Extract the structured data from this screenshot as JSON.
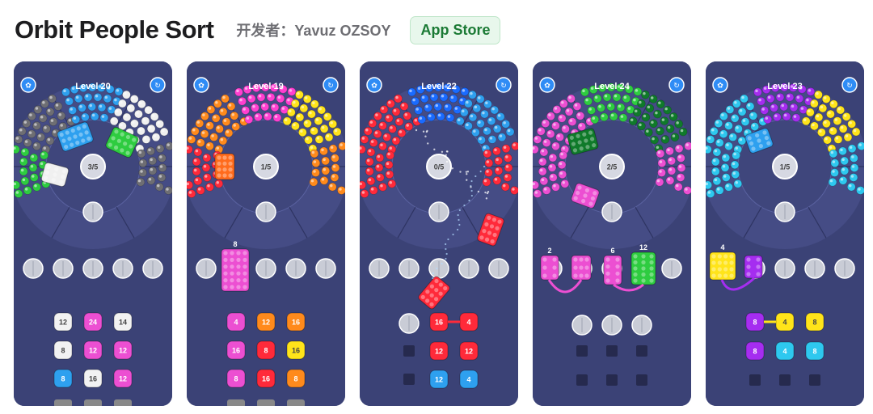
{
  "app": {
    "title": "Orbit People Sort",
    "developer": "开发者：Yavuz OZSOY",
    "store_badge": "App Store"
  },
  "screenshots": [
    {
      "level": "Level 20",
      "progress": "3/5",
      "colors": [
        "#6e6e73",
        "#2ea0ef",
        "#f0f0f0",
        "#2ecc40"
      ],
      "tray_labels": [
        "12",
        "24",
        "14",
        "8",
        "12",
        "12",
        "8",
        "16",
        "12"
      ],
      "tray_colors": [
        "#f2f2f2",
        "#ec4fd2",
        "#f2f2f2",
        "#f2f2f2",
        "#ec4fd2",
        "#ec4fd2",
        "#2ea0ef",
        "#f2f2f2",
        "#ec4fd2"
      ]
    },
    {
      "level": "Level 19",
      "progress": "1/5",
      "colors": [
        "#ff8a1c",
        "#ff3fd0",
        "#ffe41a",
        "#ff2a3a"
      ],
      "tray_labels": [
        "4",
        "12",
        "16",
        "16",
        "8",
        "16",
        "8",
        "16",
        "8"
      ],
      "tray_colors": [
        "#ec4fd2",
        "#ff8a1c",
        "#ff8a1c",
        "#ec4fd2",
        "#ff2a3a",
        "#ffe41a",
        "#ec4fd2",
        "#ff2a3a",
        "#ff8a1c"
      ],
      "box_label": "8"
    },
    {
      "level": "Level 22",
      "progress": "0/5",
      "colors": [
        "#ff2a3a",
        "#1a6bff",
        "#2ea0ef",
        "#ff2a3a"
      ],
      "tray_labels": [
        "16",
        "4",
        "12",
        "12",
        "12",
        "4"
      ],
      "tray_colors": [
        "#ff2a3a",
        "#ff2a3a",
        "#ff2a3a",
        "#ff2a3a",
        "#2ea0ef",
        "#2ea0ef"
      ]
    },
    {
      "level": "Level 24",
      "progress": "2/5",
      "colors": [
        "#ec4fd2",
        "#2ecc40",
        "#0f7a2a",
        "#ec4fd2"
      ],
      "box_labels": [
        "2",
        "6",
        "12"
      ]
    },
    {
      "level": "Level 23",
      "progress": "1/5",
      "colors": [
        "#2ec8ef",
        "#a52df0",
        "#ffe41a",
        "#2ec8ef"
      ],
      "box_labels": [
        "4"
      ],
      "tray_labels": [
        "8",
        "4",
        "8",
        "8",
        "4",
        "8"
      ],
      "tray_colors": [
        "#a52df0",
        "#ffe41a",
        "#ffe41a",
        "#a52df0",
        "#2ec8ef",
        "#2ec8ef"
      ]
    }
  ]
}
